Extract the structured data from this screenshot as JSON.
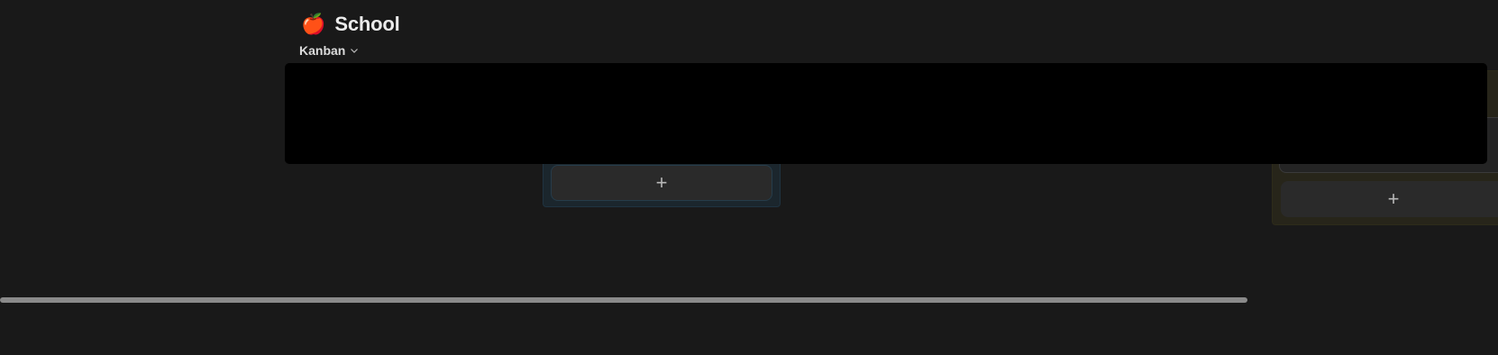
{
  "page": {
    "icon": "🍎",
    "icon_name": "apple-icon",
    "title": "School"
  },
  "view": {
    "label": "Kanban",
    "icon": "chevron-down-icon"
  },
  "board": {
    "columns": [
      {
        "color": "#1b262d",
        "add_label": "+"
      },
      {
        "color": "#27251a",
        "add_label": "+"
      }
    ]
  },
  "colors": {
    "background": "#191919",
    "redacted": "#000000",
    "scrollbar_thumb": "#8a8a8a"
  }
}
